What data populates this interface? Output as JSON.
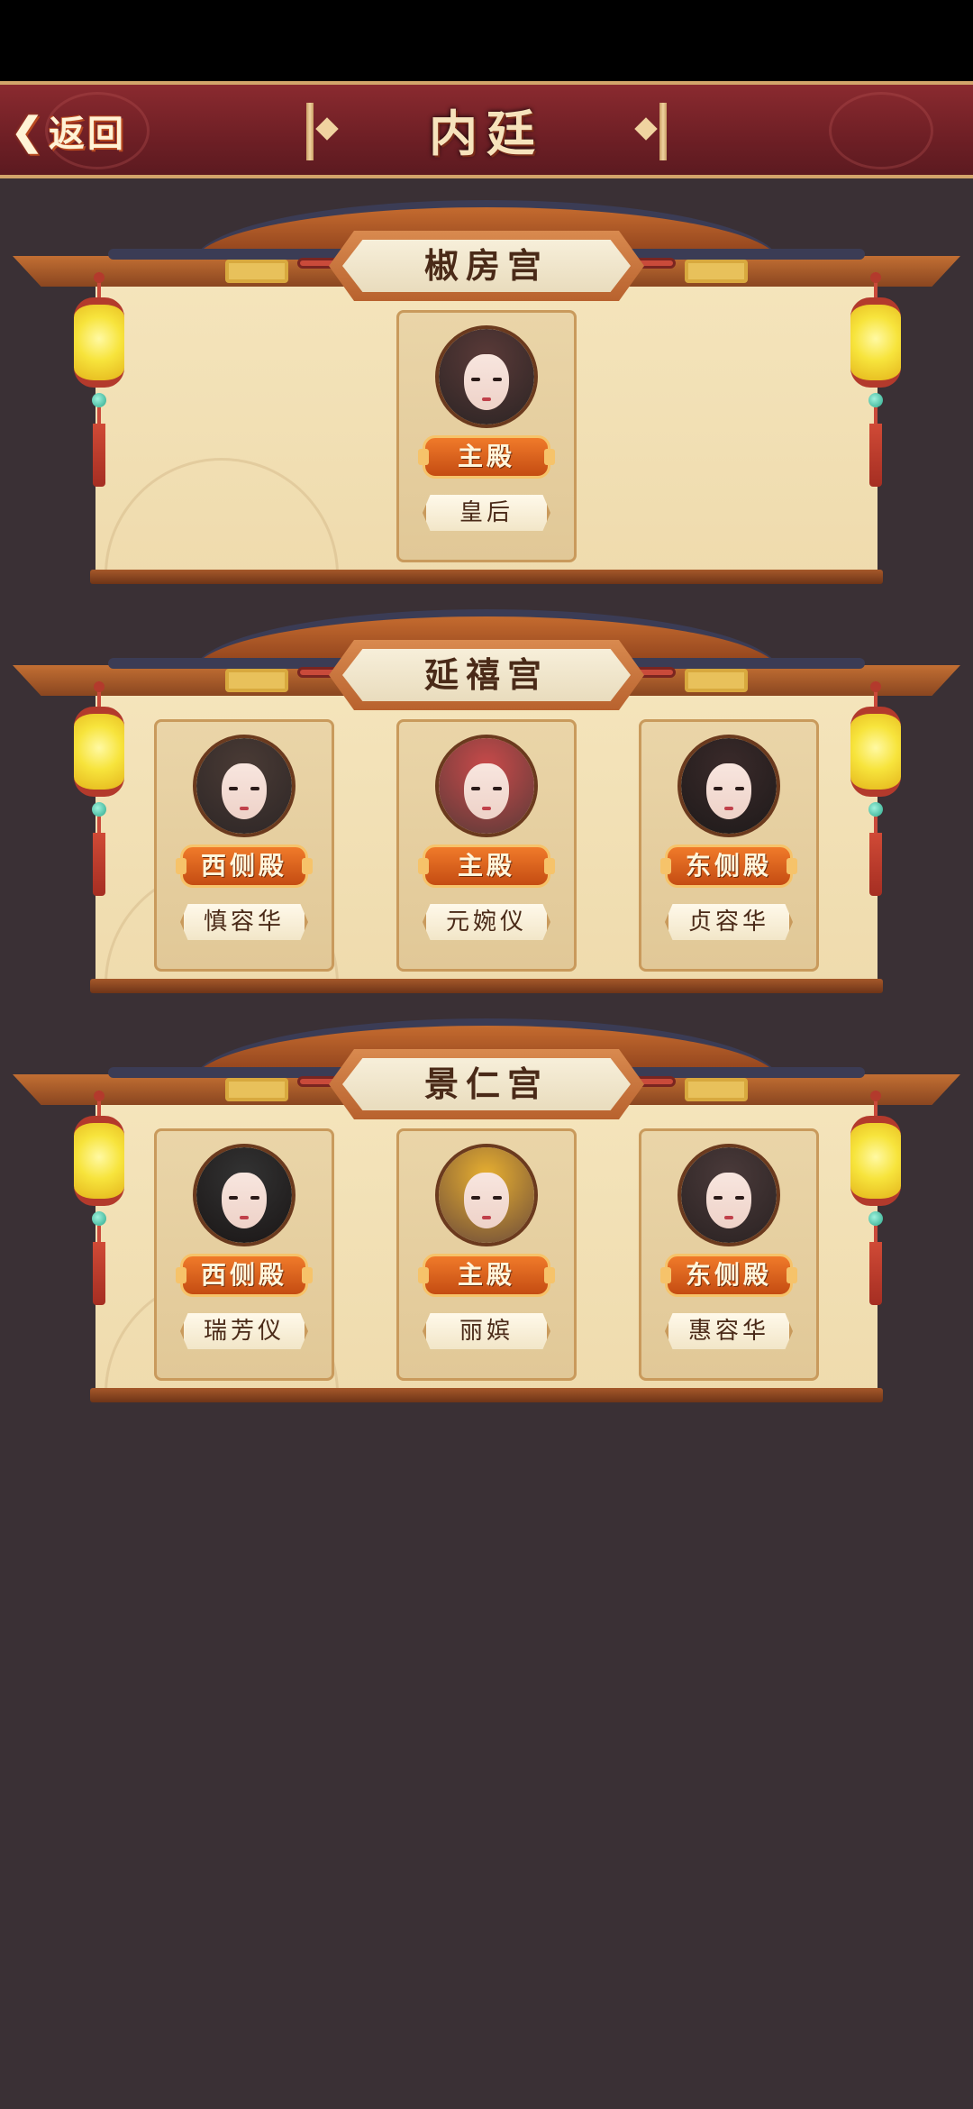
{
  "header": {
    "back_label": "返回",
    "title": "内廷"
  },
  "palaces": [
    {
      "name": "椒房宫",
      "slots": [
        {
          "hall": "主殿",
          "rank": "皇后",
          "hair": "#2b2424",
          "accent": "#5a3a38"
        }
      ]
    },
    {
      "name": "延禧宫",
      "slots": [
        {
          "hall": "西侧殿",
          "rank": "慎容华",
          "hair": "#2d2626",
          "accent": "#4a3b35"
        },
        {
          "hall": "主殿",
          "rank": "元婉仪",
          "hair": "#5a3a38",
          "accent": "#c94a4a"
        },
        {
          "hall": "东侧殿",
          "rank": "贞容华",
          "hair": "#1e1a1a",
          "accent": "#3a2a2a"
        }
      ]
    },
    {
      "name": "景仁宫",
      "slots": [
        {
          "hall": "西侧殿",
          "rank": "瑞芳仪",
          "hair": "#1a1616",
          "accent": "#333"
        },
        {
          "hall": "主殿",
          "rank": "丽嫔",
          "hair": "#6b4a3a",
          "accent": "#e8b030"
        },
        {
          "hall": "东侧殿",
          "rank": "惠容华",
          "hair": "#2a2222",
          "accent": "#4a3a3a"
        }
      ]
    }
  ]
}
